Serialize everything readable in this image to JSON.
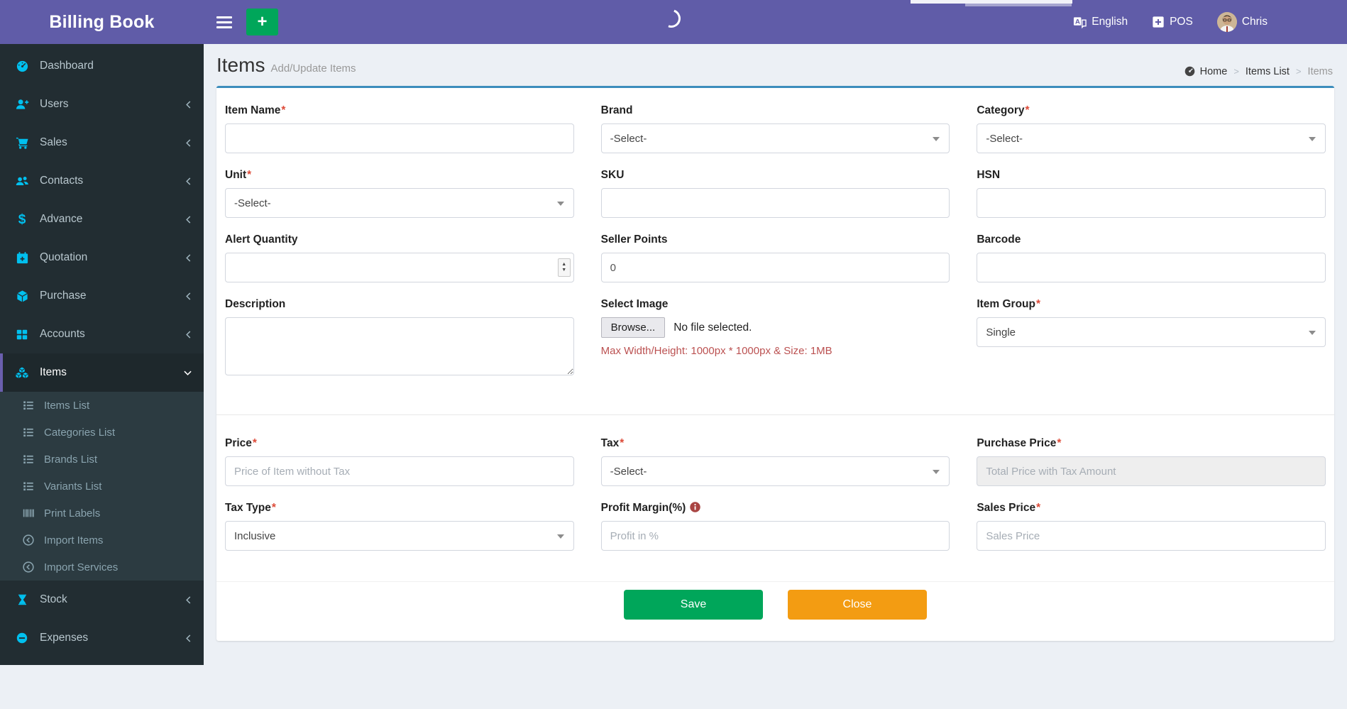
{
  "navbar": {
    "brand": "Billing Book",
    "language": "English",
    "pos": "POS",
    "user": "Chris"
  },
  "sidebar": {
    "items": [
      {
        "label": "Dashboard",
        "icon": "dashboard-icon"
      },
      {
        "label": "Users",
        "icon": "user-plus-icon"
      },
      {
        "label": "Sales",
        "icon": "cart-icon"
      },
      {
        "label": "Contacts",
        "icon": "users-icon"
      },
      {
        "label": "Advance",
        "icon": "dollar-icon"
      },
      {
        "label": "Quotation",
        "icon": "calendar-plus-icon"
      },
      {
        "label": "Purchase",
        "icon": "cube-icon"
      },
      {
        "label": "Accounts",
        "icon": "grid-icon"
      },
      {
        "label": "Items",
        "icon": "cubes-icon",
        "active": true
      },
      {
        "label": "Stock",
        "icon": "hourglass-icon"
      },
      {
        "label": "Expenses",
        "icon": "minus-circle-icon"
      }
    ],
    "items_submenu": [
      {
        "label": "Items List",
        "icon": "list-icon"
      },
      {
        "label": "Categories List",
        "icon": "list-icon"
      },
      {
        "label": "Brands List",
        "icon": "list-icon"
      },
      {
        "label": "Variants List",
        "icon": "list-icon"
      },
      {
        "label": "Print Labels",
        "icon": "barcode-icon"
      },
      {
        "label": "Import Items",
        "icon": "import-icon"
      },
      {
        "label": "Import Services",
        "icon": "import-icon"
      }
    ]
  },
  "page": {
    "title": "Items",
    "subtitle": "Add/Update Items",
    "breadcrumb": {
      "home": "Home",
      "items_list": "Items List",
      "current": "Items"
    }
  },
  "form": {
    "fields": {
      "item_name": {
        "label": "Item Name",
        "required": "*",
        "value": ""
      },
      "brand": {
        "label": "Brand",
        "value": "-Select-"
      },
      "category": {
        "label": "Category",
        "required": "*",
        "value": "-Select-"
      },
      "unit": {
        "label": "Unit",
        "required": "*",
        "value": "-Select-"
      },
      "sku": {
        "label": "SKU",
        "value": ""
      },
      "hsn": {
        "label": "HSN",
        "value": ""
      },
      "alert_quantity": {
        "label": "Alert Quantity",
        "value": ""
      },
      "seller_points": {
        "label": "Seller Points",
        "value": "0"
      },
      "barcode": {
        "label": "Barcode",
        "value": ""
      },
      "description": {
        "label": "Description",
        "value": ""
      },
      "select_image": {
        "label": "Select Image",
        "browse": "Browse...",
        "no_file": "No file selected.",
        "note": "Max Width/Height: 1000px * 1000px & Size: 1MB"
      },
      "item_group": {
        "label": "Item Group",
        "required": "*",
        "value": "Single"
      },
      "price": {
        "label": "Price",
        "required": "*",
        "placeholder": "Price of Item without Tax"
      },
      "tax": {
        "label": "Tax",
        "required": "*",
        "value": "-Select-"
      },
      "purchase_price": {
        "label": "Purchase Price",
        "required": "*",
        "placeholder": "Total Price with Tax Amount",
        "disabled": true
      },
      "tax_type": {
        "label": "Tax Type",
        "required": "*",
        "value": "Inclusive"
      },
      "profit_margin": {
        "label": "Profit Margin(%)",
        "placeholder": "Profit in %"
      },
      "sales_price": {
        "label": "Sales Price",
        "required": "*",
        "placeholder": "Sales Price"
      }
    },
    "buttons": {
      "save": "Save",
      "close": "Close"
    }
  },
  "colors": {
    "navbar": "#605ca8",
    "sidebar": "#222d32",
    "submenu": "#2c3b41",
    "card_top_border": "#3c8dbc",
    "icon_cyan": "#00c0ef",
    "save_green": "#00a65a",
    "close_orange": "#f39c12",
    "required_red": "#dd4b39",
    "note_red": "#bb5151"
  }
}
